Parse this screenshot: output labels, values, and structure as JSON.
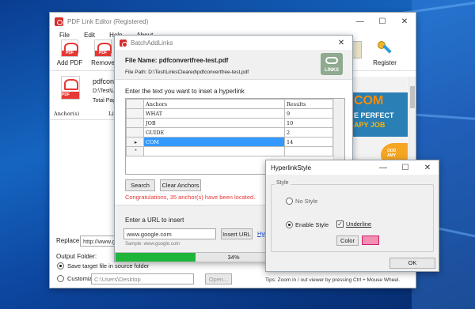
{
  "main_window": {
    "title": "PDF Link Editor (Registered)",
    "menu": [
      "File",
      "Edit",
      "Help",
      "About"
    ],
    "toolbar": {
      "add_pdf": "Add PDF",
      "remove": "Remove",
      "register": "Register"
    },
    "file_item": {
      "name": "pdfconvert",
      "path": "D:\\Test\\Links",
      "total": "Total Pag"
    },
    "columns": {
      "anchor": "Anchor(s)",
      "links": "Lin"
    },
    "replace_label": "Replace:",
    "replace_value": "http://www.goo",
    "output_folder_label": "Output Folder:",
    "save_in_source": "Save target file in source folder",
    "customize_label": "Customize:",
    "customize_value": "C:\\Users\\Desktop",
    "open_button": "Open...",
    "tips": "Tips: Zoom in / out viewer by pressing Ctrl + Mouse Wheel.",
    "preview_banner": {
      "line1": "COM",
      "line2": "E PERFECT",
      "line3": "APY JOB",
      "line4": "OOD",
      "line5": "AMY"
    }
  },
  "batch_dialog": {
    "title": "BatchAddLinks",
    "file_name_label": "File Name:",
    "file_name": "pdfconvertfree-test.pdf",
    "file_path_label": "File Path:",
    "file_path": "D:\\Test\\LinksCleared\\pdfconvertfree-test.pdf",
    "logo_text": "LINKS",
    "enter_text_label": "Enter the text you want to inset a hyperlink",
    "table_headers": {
      "anchors": "Anchors",
      "results": "Results"
    },
    "rows": [
      {
        "anchor": "WHAT",
        "result": "9"
      },
      {
        "anchor": "JOB",
        "result": "10"
      },
      {
        "anchor": "GUIDE",
        "result": "2"
      },
      {
        "anchor": "COM",
        "result": "14"
      },
      {
        "anchor": "",
        "result": ""
      }
    ],
    "row_marker": "▸",
    "new_row_marker": "*",
    "search_button": "Search",
    "clear_button": "Clear Anchors",
    "status": "Congratulations, 35 anchor(s) have been located.",
    "url_label": "Enter a URL to insert",
    "url_value": "www.google.com",
    "insert_url_button": "Insert URL",
    "hyperlink_link": "Hyp",
    "sample": "Sample: www.google.com",
    "progress_text": "34%",
    "progress": 0.34
  },
  "style_dialog": {
    "title": "HyperlinkStyle",
    "group_label": "Style",
    "no_style": "No Style",
    "enable_style": "Enable Style",
    "underline": "Underline",
    "color_button": "Color",
    "swatch_color": "#f48fb1",
    "ok_button": "OK"
  },
  "colors": {
    "accent": "#3399ff",
    "progress": "#1eb53a",
    "status_red": "#e53935"
  }
}
